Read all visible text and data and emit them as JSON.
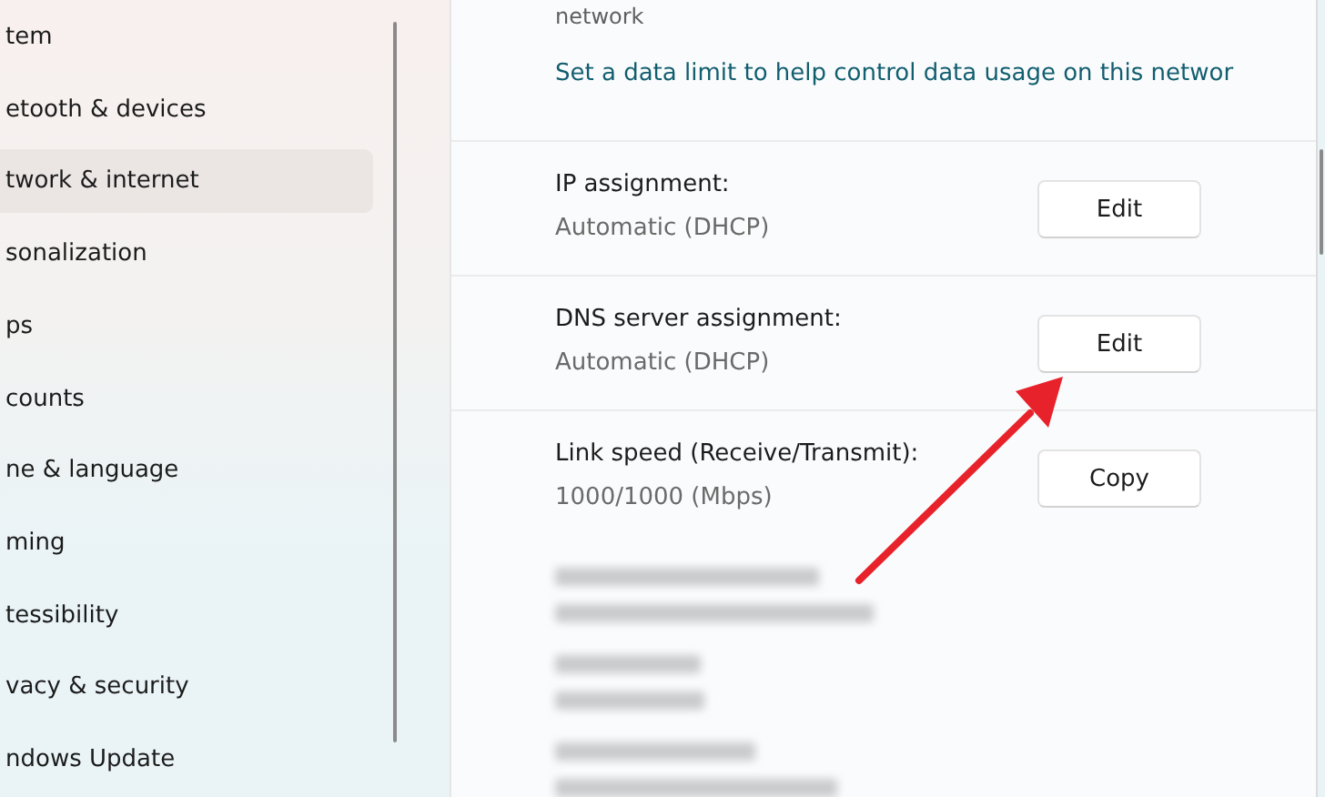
{
  "sidebar": {
    "items": [
      {
        "label": "tem",
        "selected": false
      },
      {
        "label": "etooth & devices",
        "selected": false
      },
      {
        "label": "twork & internet",
        "selected": true
      },
      {
        "label": "sonalization",
        "selected": false
      },
      {
        "label": "ps",
        "selected": false
      },
      {
        "label": "counts",
        "selected": false
      },
      {
        "label": "ne & language",
        "selected": false
      },
      {
        "label": "ming",
        "selected": false
      },
      {
        "label": "tessibility",
        "selected": false
      },
      {
        "label": "vacy & security",
        "selected": false
      },
      {
        "label": "ndows Update",
        "selected": false
      }
    ]
  },
  "data_limit": {
    "note": "network",
    "link": "Set a data limit to help control data usage on this networ"
  },
  "properties": [
    {
      "label": "IP assignment:",
      "value": "Automatic (DHCP)",
      "button": "Edit"
    },
    {
      "label": "DNS server assignment:",
      "value": "Automatic (DHCP)",
      "button": "Edit"
    },
    {
      "label": "Link speed (Receive/Transmit):",
      "value": "1000/1000 (Mbps)",
      "button": "Copy"
    }
  ]
}
